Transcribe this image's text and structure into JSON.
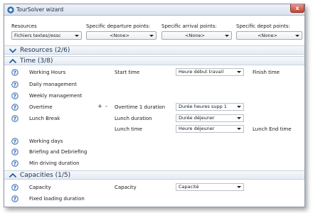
{
  "window": {
    "title": "TourSolver wizard",
    "close_glyph": "x"
  },
  "header": {
    "resources": {
      "label": "Resources",
      "value": "Fichiers textes//essc"
    },
    "departure": {
      "label": "Specific departure points:",
      "value": "<None>"
    },
    "arrival": {
      "label": "Specific arrival points:",
      "value": "<None>"
    },
    "depot": {
      "label": "Specific depot points:",
      "value": "<None>"
    }
  },
  "sections": {
    "resources": {
      "title": "Resources (2/6)",
      "collapsed": true
    },
    "time": {
      "title": "Time (3/8)",
      "collapsed": false
    },
    "capacities": {
      "title": "Capacities (1/5)",
      "collapsed": false
    }
  },
  "time_rows": {
    "working_hours": {
      "label": "Working Hours",
      "field": "Start time",
      "value": "Heure début travail",
      "extra": "Finish time"
    },
    "daily_management": {
      "label": "Daily management"
    },
    "weekly_management": {
      "label": "Weekly management"
    },
    "overtime": {
      "label": "Overtime",
      "plus": "+",
      "minus": "-",
      "field": "Overtime 1 duration",
      "value": "Durée heures supp 1"
    },
    "lunch_break": {
      "label": "Lunch Break",
      "field": "Lunch duration",
      "value": "Durée déjeuner"
    },
    "lunch_time": {
      "field": "Lunch time",
      "value": "Heure déjeuner",
      "extra": "Lunch End time"
    },
    "working_days": {
      "label": "Working days"
    },
    "briefing": {
      "label": "Briefing and Debriefing"
    },
    "min_driving": {
      "label": "Min driving duration"
    }
  },
  "capacity_rows": {
    "capacity": {
      "label": "Capacity",
      "field": "Capacity",
      "value": "Capacité"
    },
    "fixed_loading": {
      "label": "Fixed loading duration"
    }
  },
  "icons": {
    "help": "help-icon",
    "expand": "chevron-down-icon",
    "collapse": "chevron-up-icon",
    "app": "app-icon"
  }
}
